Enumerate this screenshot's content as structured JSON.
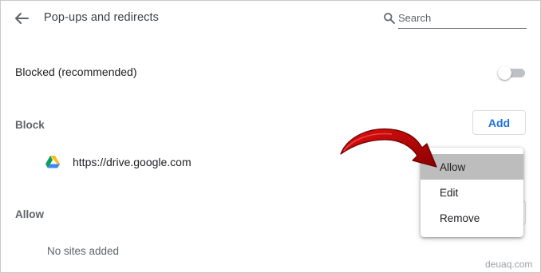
{
  "header": {
    "back_icon": "arrow-back-icon",
    "title": "Pop-ups and redirects",
    "search_placeholder": "Search",
    "search_icon": "search-icon"
  },
  "blocked_setting": {
    "label": "Blocked (recommended)",
    "toggle_on": false
  },
  "block_section": {
    "heading": "Block",
    "add_label": "Add",
    "sites": [
      {
        "url": "https://drive.google.com",
        "icon": "google-drive-icon"
      }
    ]
  },
  "allow_section": {
    "heading": "Allow",
    "empty_text": "No sites added"
  },
  "context_menu": {
    "items": [
      {
        "label": "Allow",
        "highlighted": true
      },
      {
        "label": "Edit",
        "highlighted": false
      },
      {
        "label": "Remove",
        "highlighted": false
      }
    ]
  },
  "annotation": {
    "arrow_color": "#c00000"
  },
  "watermark": "deuaq.com",
  "colors": {
    "accent_blue": "#1a73e8",
    "text_primary": "#202124",
    "text_secondary": "#5f6368",
    "menu_highlight": "#bdbdbd"
  }
}
